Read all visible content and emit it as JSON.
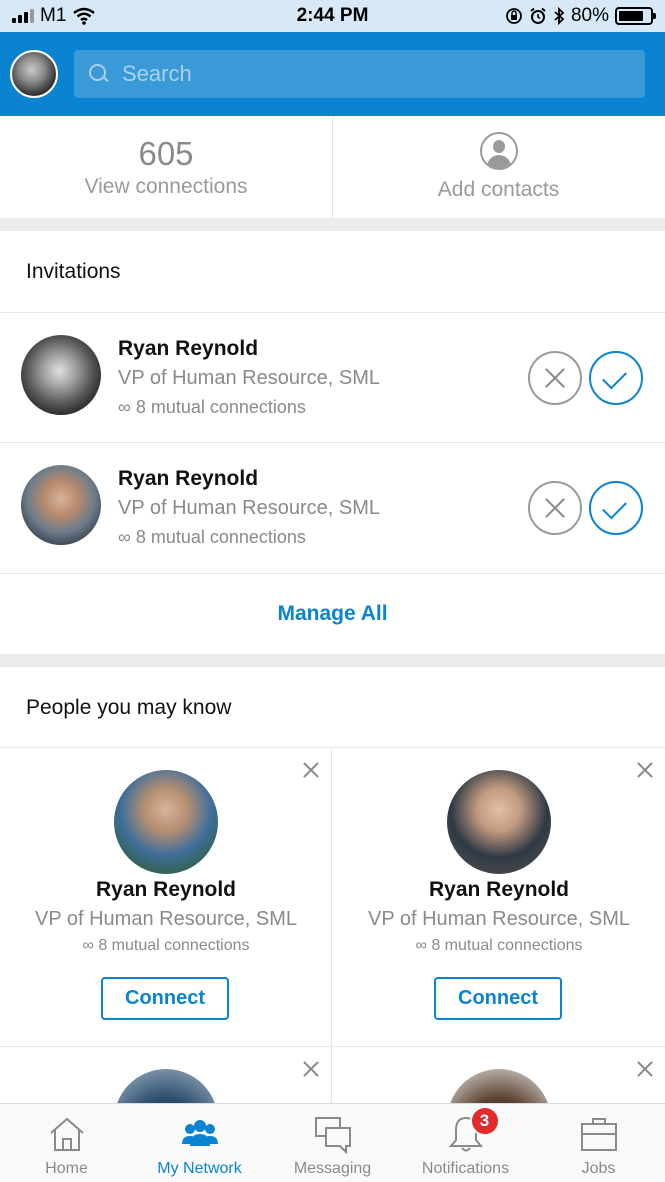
{
  "status_bar": {
    "carrier": "M1",
    "time": "2:44 PM",
    "battery": "80%",
    "battery_level": 0.8
  },
  "header": {
    "search_placeholder": "Search"
  },
  "connections": {
    "count": "605",
    "view_label": "View connections",
    "add_contacts_label": "Add contacts"
  },
  "invitations": {
    "title": "Invitations",
    "items": [
      {
        "name": "Ryan Reynold",
        "title": "VP of Human Resource, SML",
        "mutual": "∞ 8 mutual connections"
      },
      {
        "name": "Ryan Reynold",
        "title": "VP of Human Resource, SML",
        "mutual": "∞ 8 mutual connections"
      }
    ],
    "manage_all": "Manage All"
  },
  "pymk": {
    "title": "People you may know",
    "cards": [
      {
        "name": "Ryan Reynold",
        "title": "VP of Human Resource, SML",
        "mutual": "∞ 8 mutual connections",
        "button": "Connect"
      },
      {
        "name": "Ryan Reynold",
        "title": "VP of Human Resource, SML",
        "mutual": "∞ 8 mutual connections",
        "button": "Connect"
      }
    ]
  },
  "tabbar": {
    "tabs": [
      {
        "label": "Home",
        "icon": "home-icon"
      },
      {
        "label": "My Network",
        "icon": "network-icon",
        "active": true
      },
      {
        "label": "Messaging",
        "icon": "messaging-icon"
      },
      {
        "label": "Notifications",
        "icon": "bell-icon",
        "badge": "3"
      },
      {
        "label": "Jobs",
        "icon": "briefcase-icon"
      }
    ]
  },
  "colors": {
    "brand": "#0a84d0",
    "status_bar_bg": "#d7e9f7",
    "badge": "#e32b2b"
  }
}
